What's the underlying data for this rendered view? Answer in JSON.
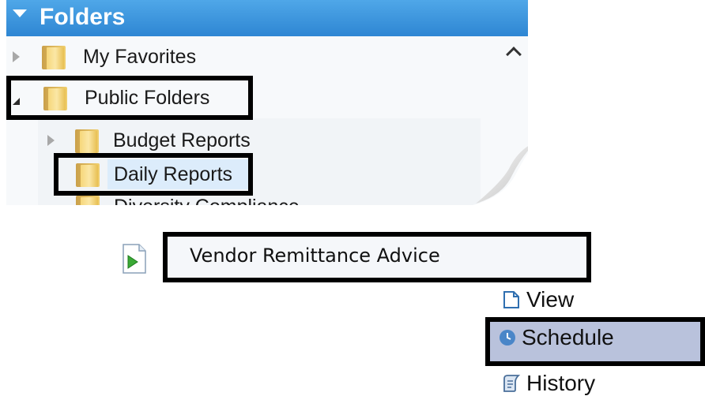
{
  "folders_panel": {
    "header_title": "Folders",
    "items": [
      {
        "label": "My Favorites",
        "expanded": false
      },
      {
        "label": "Public Folders",
        "expanded": true
      },
      {
        "label": "Budget Reports",
        "expanded": false
      },
      {
        "label": "Daily Reports",
        "selected": true
      },
      {
        "label": "Diversity Compliance"
      }
    ]
  },
  "report": {
    "name": "Vendor Remittance Advice",
    "icon": "report-run-icon"
  },
  "actions": [
    {
      "label": "View",
      "icon": "view-page-icon"
    },
    {
      "label": "Schedule",
      "icon": "clock-icon",
      "highlighted": true
    },
    {
      "label": "History",
      "icon": "history-icon"
    }
  ],
  "colors": {
    "header": "#3a96dd",
    "selection": "#dcecfb",
    "schedule_highlight": "#b9c2dc"
  }
}
